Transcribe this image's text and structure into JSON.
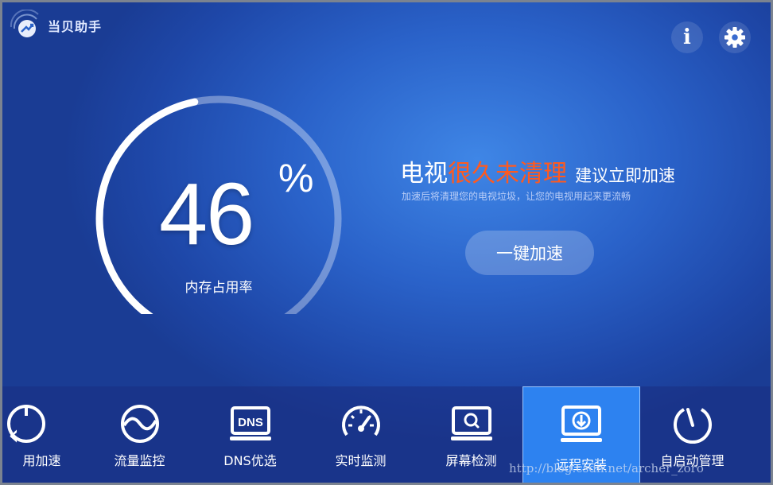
{
  "app": {
    "title": "当贝助手"
  },
  "header": {
    "info_icon": "info-icon",
    "settings_icon": "gear-icon"
  },
  "gauge": {
    "value": "46",
    "unit": "%",
    "label": "内存占用率",
    "fraction": 0.46
  },
  "message": {
    "headline_part1": "电视",
    "headline_part2": "很久未清理",
    "headline_part3": "建议立即加速",
    "subtitle": "加速后将清理您的电视垃圾，让您的电视用起来更流畅",
    "accent_color": "#ff5a1f"
  },
  "boost_button": "一键加速",
  "toolbar": {
    "items": [
      {
        "label": "用加速",
        "icon": "speedup-icon"
      },
      {
        "label": "流量监控",
        "icon": "traffic-icon"
      },
      {
        "label": "DNS优选",
        "icon": "dns-icon"
      },
      {
        "label": "实时监测",
        "icon": "speedometer-icon"
      },
      {
        "label": "屏幕检测",
        "icon": "screen-check-icon"
      },
      {
        "label": "远程安装",
        "icon": "remote-install-icon",
        "selected": true
      },
      {
        "label": "自启动管理",
        "icon": "autostart-icon"
      }
    ],
    "dns_text": "DNS"
  },
  "watermark": "http://blog.csdn.net/archer_zoro",
  "colors": {
    "background": "#2a62c9",
    "selected_tile": "#2d82f0"
  }
}
